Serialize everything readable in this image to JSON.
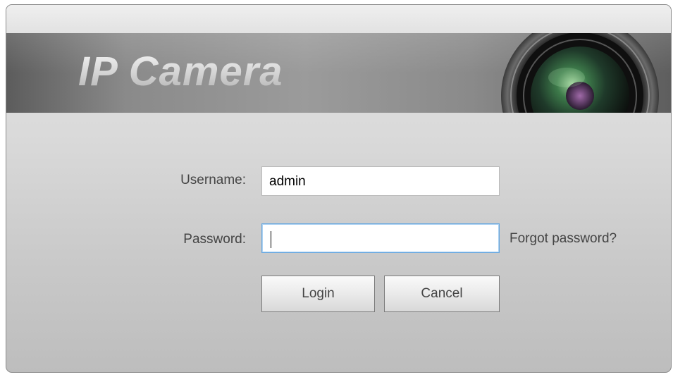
{
  "banner": {
    "title": "IP Camera"
  },
  "form": {
    "username_label": "Username:",
    "username_value": "admin",
    "password_label": "Password:",
    "password_value": "",
    "forgot_password": "Forgot password?",
    "login_label": "Login",
    "cancel_label": "Cancel"
  },
  "icons": {
    "banner_graphic": "camera-lens-icon"
  },
  "colors": {
    "banner_dark": "#5c5c5c",
    "banner_light": "#9b9b9b",
    "focus_border": "#66a7e0",
    "label_text": "#444444"
  }
}
